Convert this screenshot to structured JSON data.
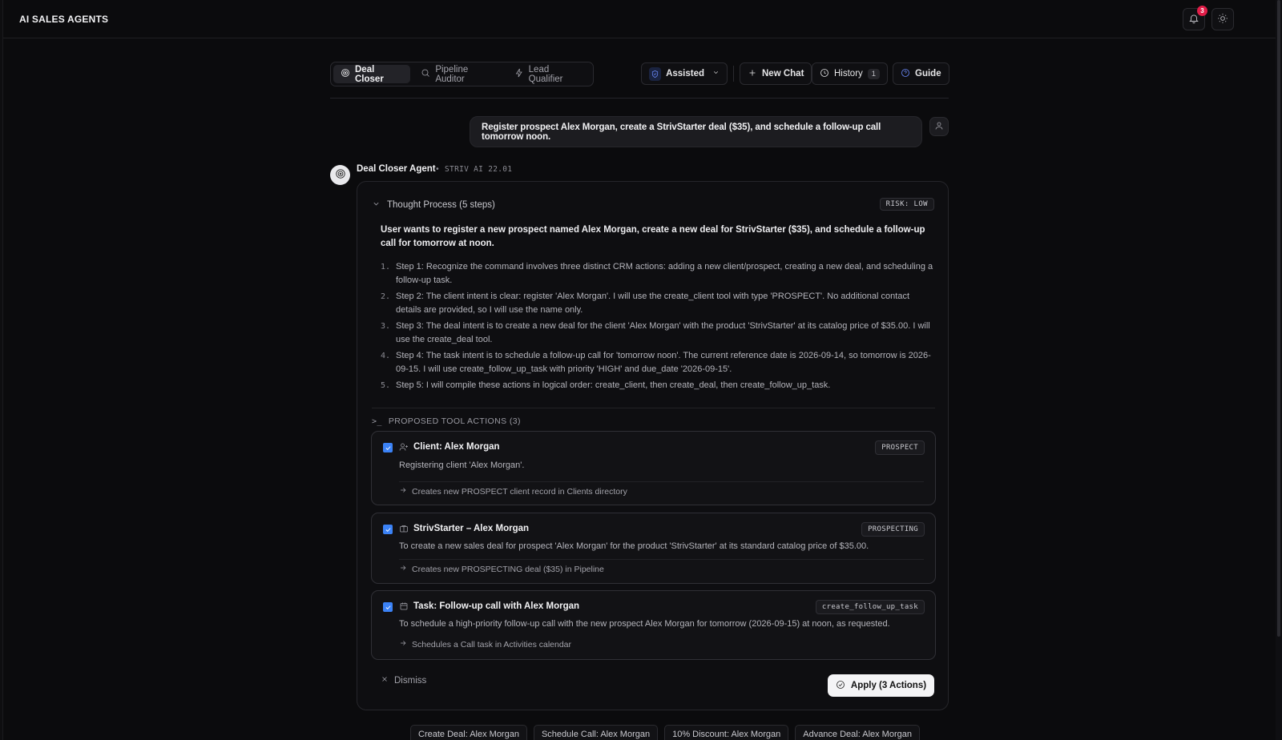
{
  "app": {
    "title": "AI SALES AGENTS",
    "notification_count": "3"
  },
  "agent_tabs": [
    {
      "label": "Deal Closer",
      "icon": "target-icon",
      "active": true
    },
    {
      "label": "Pipeline Auditor",
      "icon": "search-icon",
      "active": false
    },
    {
      "label": "Lead Qualifier",
      "icon": "bolt-icon",
      "active": false
    }
  ],
  "toolbar": {
    "mode_label": "Assisted",
    "new_chat_label": "New Chat",
    "history_label": "History",
    "history_count": "1",
    "guide_label": "Guide"
  },
  "user_message": "Register prospect Alex Morgan, create a StrivStarter deal ($35), and schedule a follow-up call tomorrow noon.",
  "agent": {
    "name": "Deal Closer Agent",
    "meta": "• STRIV AI 22.01"
  },
  "thought": {
    "header": "Thought Process (5 steps)",
    "risk": "RISK: LOW",
    "summary": "User wants to register a new prospect named Alex Morgan, create a new deal for StrivStarter ($35), and schedule a follow-up call for tomorrow at noon.",
    "steps": [
      {
        "num": "1.",
        "text": "Step 1: Recognize the command involves three distinct CRM actions: adding a new client/prospect, creating a new deal, and scheduling a follow-up task."
      },
      {
        "num": "2.",
        "text": "Step 2: The client intent is clear: register 'Alex Morgan'. I will use the create_client tool with type 'PROSPECT'. No additional contact details are provided, so I will use the name only."
      },
      {
        "num": "3.",
        "text": "Step 3: The deal intent is to create a new deal for the client 'Alex Morgan' with the product 'StrivStarter' at its catalog price of $35.00. I will use the create_deal tool."
      },
      {
        "num": "4.",
        "text": "Step 4: The task intent is to schedule a follow-up call for 'tomorrow noon'. The current reference date is 2026-09-14, so tomorrow is 2026-09-15. I will use create_follow_up_task with priority 'HIGH' and due_date '2026-09-15'."
      },
      {
        "num": "5.",
        "text": "Step 5: I will compile these actions in logical order: create_client, then create_deal, then create_follow_up_task."
      }
    ]
  },
  "actions_header": {
    "prompt": ">_",
    "label": "PROPOSED TOOL ACTIONS (3)"
  },
  "actions": [
    {
      "icon": "user-plus-icon",
      "title": "Client: Alex Morgan",
      "tag": "PROSPECT",
      "desc": "Registering client 'Alex Morgan'.",
      "effect": "Creates new PROSPECT client record in Clients directory",
      "checked": true
    },
    {
      "icon": "briefcase-icon",
      "title": "StrivStarter – Alex Morgan",
      "tag": "PROSPECTING",
      "desc": "To create a new sales deal for prospect 'Alex Morgan' for the product 'StrivStarter' at its standard catalog price of $35.00.",
      "effect": "Creates new PROSPECTING deal ($35) in Pipeline",
      "checked": true
    },
    {
      "icon": "calendar-icon",
      "title": "Task: Follow-up call with Alex Morgan",
      "tag": "create_follow_up_task",
      "desc": "To schedule a high-priority follow-up call with the new prospect Alex Morgan for tomorrow (2026-09-15) at noon, as requested.",
      "effect": "Schedules a Call task in Activities calendar",
      "checked": true
    }
  ],
  "footer": {
    "dismiss_label": "Dismiss",
    "apply_label": "Apply (3 Actions)"
  },
  "suggestions": [
    "Create Deal: Alex Morgan",
    "Schedule Call: Alex Morgan",
    "10% Discount: Alex Morgan",
    "Advance Deal: Alex Morgan"
  ],
  "colors": {
    "accent": "#3b82f6",
    "badge": "#e11d48",
    "background": "#0b0b0d"
  }
}
